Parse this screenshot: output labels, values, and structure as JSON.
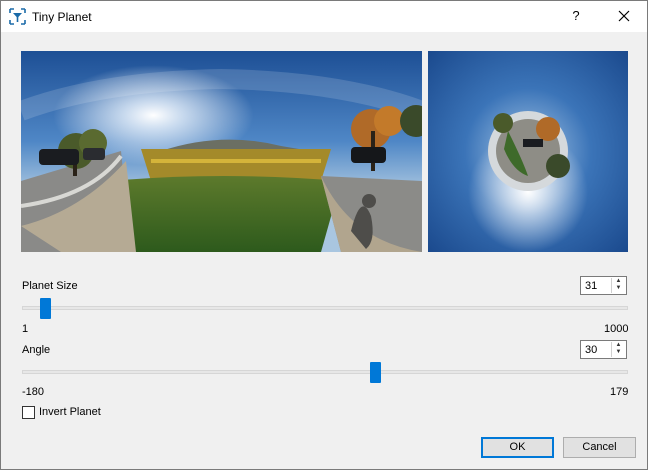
{
  "window": {
    "title": "Tiny Planet",
    "help_label": "?"
  },
  "previews": {
    "source_image": "equirectangular panorama of vineyard road with parked cars and sun",
    "result_image": "tiny planet projection of the panorama"
  },
  "planet_size": {
    "label": "Planet Size",
    "value": "31",
    "min_label": "1",
    "max_label": "1000",
    "min": 1,
    "max": 1000,
    "current": 31
  },
  "angle": {
    "label": "Angle",
    "value": "30",
    "min_label": "-180",
    "max_label": "179",
    "min": -180,
    "max": 179,
    "current": 30
  },
  "invert": {
    "label": "Invert Planet",
    "checked": false
  },
  "buttons": {
    "ok": "OK",
    "cancel": "Cancel"
  },
  "colors": {
    "accent": "#0078d7",
    "background": "#f0f0f0"
  }
}
